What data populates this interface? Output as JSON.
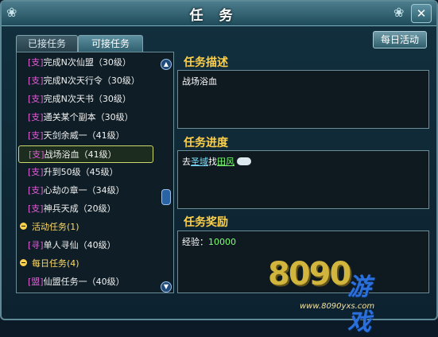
{
  "window": {
    "title": "任务"
  },
  "tabs": [
    {
      "label": "已接任务"
    },
    {
      "label": "可接任务"
    }
  ],
  "daily_button": "每日活动",
  "quest_list": {
    "rows": [
      {
        "tag": "[支]",
        "text": "完成N次仙盟（30级）"
      },
      {
        "tag": "[支]",
        "text": "完成N次天行令（30级）"
      },
      {
        "tag": "[支]",
        "text": "完成N次天书（30级）"
      },
      {
        "tag": "[支]",
        "text": "通关某个副本（30级）"
      },
      {
        "tag": "[支]",
        "text": "天剑余威一（41级）"
      },
      {
        "tag": "[支]",
        "text": "战场浴血（41级）"
      },
      {
        "tag": "[支]",
        "text": "升到50级（45级）"
      },
      {
        "tag": "[支]",
        "text": "心劫の章一（34级）"
      },
      {
        "tag": "[支]",
        "text": "神兵天成（20级）"
      }
    ],
    "categories": [
      {
        "label": "活动任务(1)"
      },
      {
        "label": "每日任务(4)"
      }
    ],
    "activity_row": {
      "tag": "[寻]",
      "text": "单人寻仙（40级）"
    },
    "daily_row": {
      "tag": "[盟]",
      "text": "仙盟任务一（40级）"
    }
  },
  "description": {
    "heading": "任务描述",
    "text": "战场浴血"
  },
  "progress": {
    "heading": "任务进度",
    "prefix": "去",
    "place": "圣域",
    "verb": "找",
    "npc": "田风"
  },
  "reward": {
    "heading": "任务奖励",
    "label": "经验：",
    "value": "10000"
  },
  "watermark": {
    "digits": "8090",
    "brand": "游戏",
    "url": "www.8090yxs.com"
  }
}
